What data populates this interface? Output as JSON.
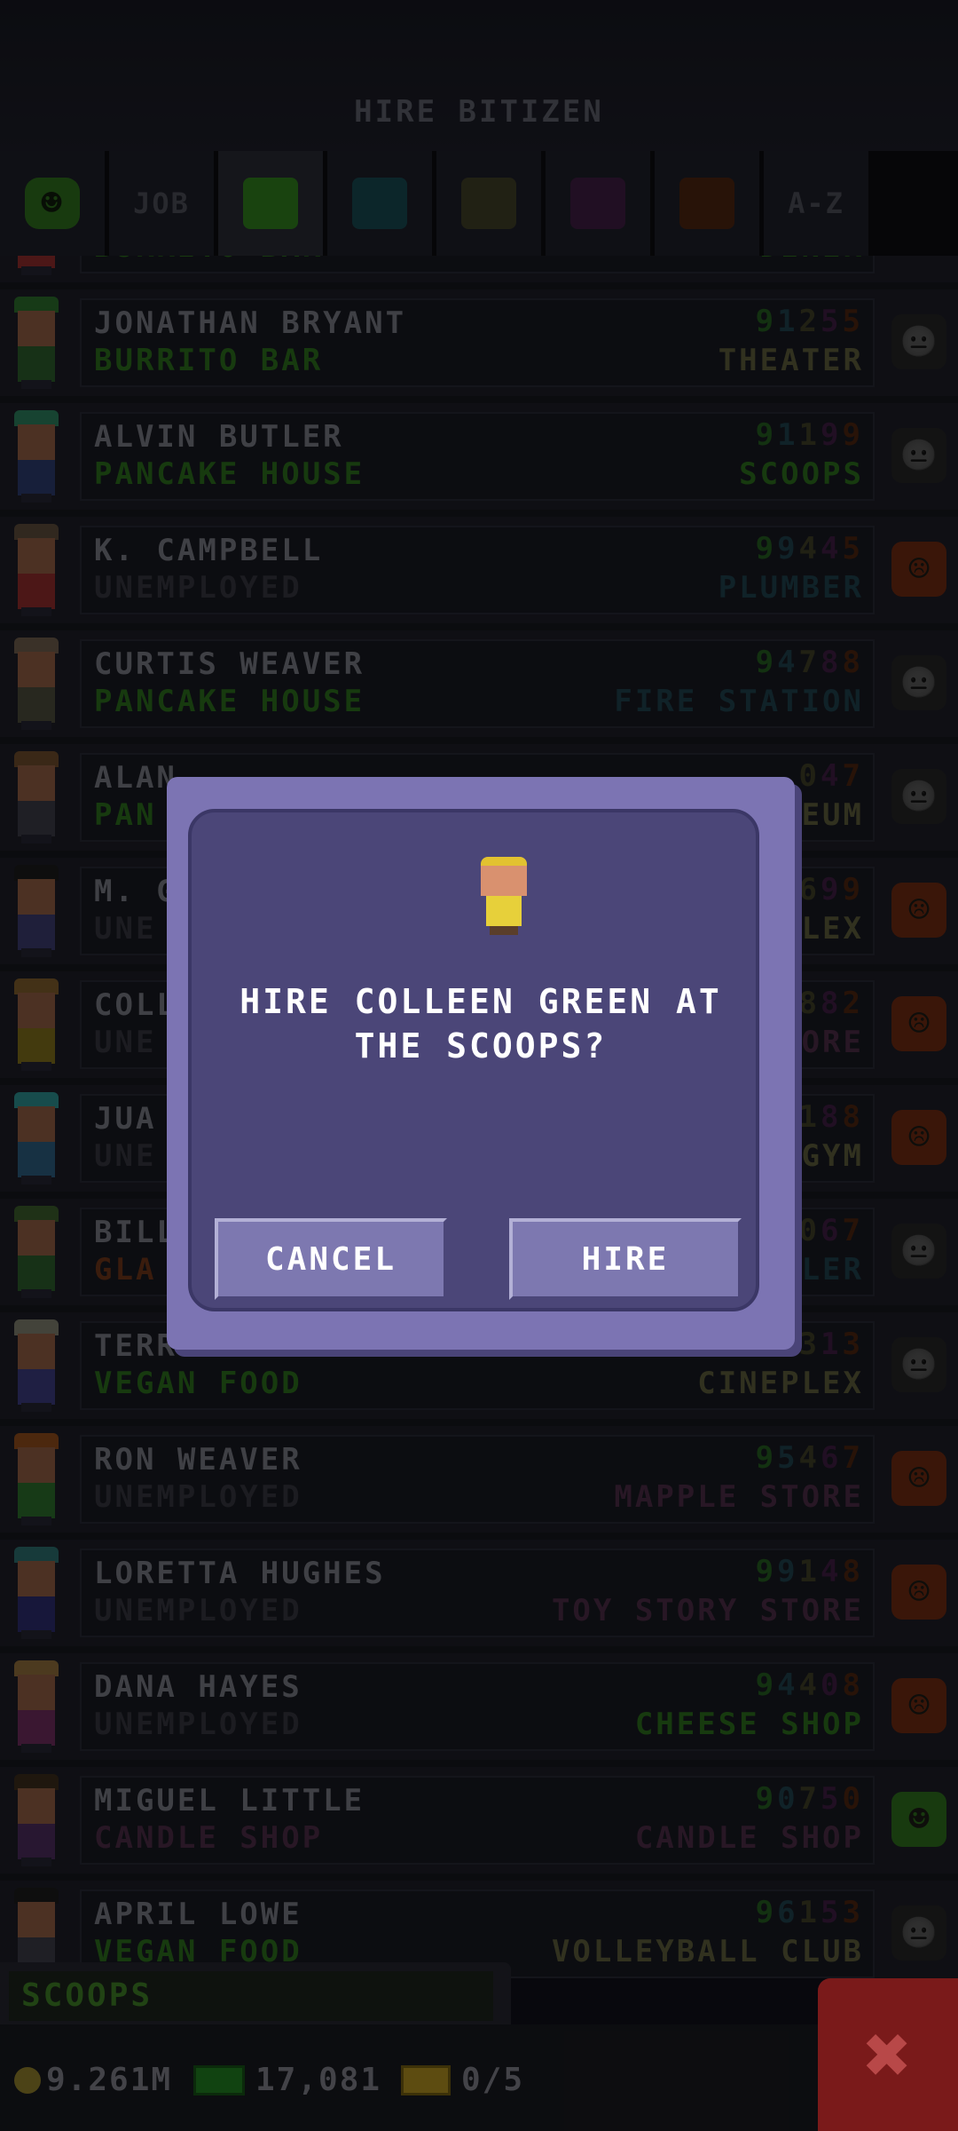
{
  "header": {
    "title": "HIRE BITIZEN"
  },
  "tabs": [
    {
      "type": "icon",
      "name": "mood-sort-tab",
      "color": "#2c6b1c"
    },
    {
      "type": "text",
      "name": "job-sort-tab",
      "label": "JOB"
    },
    {
      "type": "swatch",
      "name": "food-category-tab",
      "color": "#2e7a1d",
      "active": true
    },
    {
      "type": "swatch",
      "name": "service-category-tab",
      "color": "#16464e"
    },
    {
      "type": "swatch",
      "name": "recreation-category-tab",
      "color": "#3d3c25"
    },
    {
      "type": "swatch",
      "name": "retail-category-tab",
      "color": "#3c1d40"
    },
    {
      "type": "swatch",
      "name": "creative-category-tab",
      "color": "#4a2410"
    },
    {
      "type": "text",
      "name": "alphabetical-sort-tab",
      "label": "A-Z"
    }
  ],
  "rows": [
    {
      "name": "",
      "job": "BURRITO BAR",
      "job_color": "#2b6b1c",
      "dream": "DINER",
      "dream_color": "#2b6b1c",
      "stats": "",
      "mood": "neutral",
      "partial": true,
      "hair": "#8a3a1a",
      "shirt": "#8a2a2a"
    },
    {
      "name": "JONATHAN BRYANT",
      "job": "BURRITO BAR",
      "job_color": "#2b6b1c",
      "dream": "THEATER",
      "dream_color": "#5a5a3a",
      "stats": [
        "9",
        "1",
        "2",
        "5",
        "5"
      ],
      "mood": "neutral",
      "hair": "#2a6a2a",
      "shirt": "#2a5a2a"
    },
    {
      "name": "ALVIN BUTLER",
      "job": "PANCAKE HOUSE",
      "job_color": "#2b6b1c",
      "dream": "SCOOPS",
      "dream_color": "#2b6b1c",
      "stats": [
        "9",
        "1",
        "1",
        "9",
        "9"
      ],
      "mood": "neutral",
      "hair": "#2a7a5a",
      "shirt": "#2a3a6a"
    },
    {
      "name": "K. CAMPBELL",
      "job": "UNEMPLOYED",
      "job_color": "#33343c",
      "dream": "PLUMBER",
      "dream_color": "#1e3e4a",
      "stats": [
        "9",
        "9",
        "4",
        "4",
        "5"
      ],
      "mood": "sad",
      "hair": "#5a4a3a",
      "shirt": "#8a2a2a"
    },
    {
      "name": "CURTIS WEAVER",
      "job": "PANCAKE HOUSE",
      "job_color": "#2b6b1c",
      "dream": "FIRE STATION",
      "dream_color": "#1e3e4a",
      "stats": [
        "9",
        "4",
        "7",
        "8",
        "8"
      ],
      "mood": "neutral",
      "hair": "#6a5a4a",
      "shirt": "#4a4a3a"
    },
    {
      "name": "ALAN",
      "job": "PAN",
      "job_color": "#2b6b1c",
      "dream": "EUM",
      "dream_color": "#5a5a3a",
      "stats": [
        "0",
        "4",
        "7"
      ],
      "mood": "neutral",
      "hair": "#6a4a2a",
      "shirt": "#3a3a44"
    },
    {
      "name": "M. G",
      "job": "UNE",
      "job_color": "#33343c",
      "dream": "LEX",
      "dream_color": "#5a5a3a",
      "stats": [
        "6",
        "9",
        "9"
      ],
      "mood": "sad",
      "hair": "#1a1a1a",
      "shirt": "#3a3a6a"
    },
    {
      "name": "COLL",
      "job": "UNE",
      "job_color": "#33343c",
      "dream": "ORE",
      "dream_color": "#4a2a44",
      "stats": [
        "8",
        "8",
        "2"
      ],
      "mood": "sad",
      "hair": "#7a5a2a",
      "shirt": "#7a6a1a"
    },
    {
      "name": "JUA",
      "job": "UNE",
      "job_color": "#33343c",
      "dream": "GYM",
      "dream_color": "#5a5a3a",
      "stats": [
        "1",
        "8",
        "8"
      ],
      "mood": "sad",
      "hair": "#2a8a8a",
      "shirt": "#2a5a7a"
    },
    {
      "name": "BILL",
      "job": "GLA",
      "job_color": "#6a3418",
      "dream": "LLER",
      "dream_color": "#1e3e4a",
      "stats": [
        "0",
        "6",
        "7"
      ],
      "mood": "neutral",
      "hair": "#3a5a2a",
      "shirt": "#2a5a2a"
    },
    {
      "name": "TERRY ROGERS",
      "job": "VEGAN FOOD",
      "job_color": "#2b6b1c",
      "dream": "CINEPLEX",
      "dream_color": "#5a5a3a",
      "stats": [
        "9",
        "8",
        "3",
        "1",
        "3"
      ],
      "mood": "neutral",
      "hair": "#7a7a6a",
      "shirt": "#3a3a7a"
    },
    {
      "name": "RON WEAVER",
      "job": "UNEMPLOYED",
      "job_color": "#33343c",
      "dream": "MAPPLE STORE",
      "dream_color": "#4a2a44",
      "stats": [
        "9",
        "5",
        "4",
        "6",
        "7"
      ],
      "mood": "sad",
      "hair": "#8a4a1a",
      "shirt": "#2a6a2a"
    },
    {
      "name": "LORETTA HUGHES",
      "job": "UNEMPLOYED",
      "job_color": "#33343c",
      "dream": "TOY STORY STORE",
      "dream_color": "#4a2a44",
      "stats": [
        "9",
        "9",
        "1",
        "4",
        "8"
      ],
      "mood": "sad",
      "hair": "#2a6a6a",
      "shirt": "#2a2a6a"
    },
    {
      "name": "DANA HAYES",
      "job": "UNEMPLOYED",
      "job_color": "#33343c",
      "dream": "CHEESE SHOP",
      "dream_color": "#2b6b1c",
      "stats": [
        "9",
        "4",
        "4",
        "0",
        "8"
      ],
      "mood": "sad",
      "hair": "#8a6a3a",
      "shirt": "#6a2a5a"
    },
    {
      "name": "MIGUEL LITTLE",
      "job": "CANDLE SHOP",
      "job_color": "#4a2a44",
      "dream": "CANDLE SHOP",
      "dream_color": "#4a2a44",
      "stats": [
        "9",
        "0",
        "7",
        "5",
        "0"
      ],
      "mood": "happy",
      "hair": "#3a2a1a",
      "shirt": "#4a2a5a"
    },
    {
      "name": "APRIL LOWE",
      "job": "VEGAN FOOD",
      "job_color": "#2b6b1c",
      "dream": "VOLLEYBALL CLUB",
      "dream_color": "#5a5a3a",
      "stats": [
        "9",
        "6",
        "1",
        "5",
        "3"
      ],
      "mood": "neutral",
      "hair": "#1a1a1a",
      "shirt": "#3a3a44"
    }
  ],
  "stat_colors": [
    "#245a1f",
    "#1e3e4a",
    "#3d3c25",
    "#3c1d40",
    "#4a2410"
  ],
  "mood_colors": {
    "neutral": "#5c5a36",
    "sad": "#6a2812",
    "happy": "#2c6b1c"
  },
  "mood_icons": {
    "neutral": "smiley-neutral-icon",
    "sad": "smiley-sad-icon",
    "happy": "smiley-happy-icon"
  },
  "dialog": {
    "message": "HIRE COLLEEN GREEN AT THE SCOOPS?",
    "cancel_label": "CANCEL",
    "hire_label": "HIRE"
  },
  "footer": {
    "floor_label": "SCOOPS",
    "coins": "9.261M",
    "bux": "17,081",
    "tickets": "0/5"
  },
  "colors": {
    "dialog_bg": "#4b4678",
    "dialog_frame": "#7c74b3",
    "close_bg": "#7a1a1a"
  }
}
